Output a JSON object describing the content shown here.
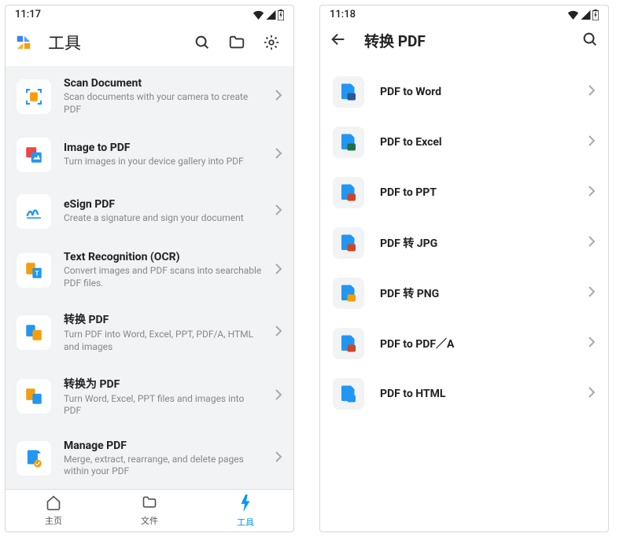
{
  "left": {
    "time": "11:17",
    "title": "工具",
    "items": [
      {
        "title": "Scan Document",
        "sub": "Scan documents with your camera to create PDF",
        "icon": "scan"
      },
      {
        "title": "Image to PDF",
        "sub": "Turn images in your device gallery into PDF",
        "icon": "img2pdf"
      },
      {
        "title": "eSign PDF",
        "sub": "Create a signature and sign your document",
        "icon": "esign"
      },
      {
        "title": "Text Recognition (OCR)",
        "sub": "Convert images and PDF scans into searchable PDF files.",
        "icon": "ocr"
      },
      {
        "title": "转换 PDF",
        "sub": "Turn PDF into Word, Excel, PPT, PDF/A, HTML and images",
        "icon": "convertfrom"
      },
      {
        "title": "转换为 PDF",
        "sub": "Turn Word, Excel, PPT files and images into PDF",
        "icon": "convertto"
      },
      {
        "title": "Manage PDF",
        "sub": "Merge, extract, rearrange, and delete pages within your PDF",
        "icon": "manage"
      }
    ],
    "nav": [
      {
        "label": "主页",
        "icon": "home"
      },
      {
        "label": "文件",
        "icon": "files"
      },
      {
        "label": "工具",
        "icon": "tools"
      }
    ]
  },
  "right": {
    "time": "11:18",
    "title": "转换 PDF",
    "items": [
      {
        "title": "PDF to Word",
        "badge": "word"
      },
      {
        "title": "PDF to Excel",
        "badge": "excel"
      },
      {
        "title": "PDF to PPT",
        "badge": "ppt"
      },
      {
        "title": "PDF 转 JPG",
        "badge": "jpg"
      },
      {
        "title": "PDF 转 PNG",
        "badge": "png"
      },
      {
        "title": "PDF to PDF／A",
        "badge": "pdfa"
      },
      {
        "title": "PDF to HTML",
        "badge": "html"
      }
    ]
  }
}
